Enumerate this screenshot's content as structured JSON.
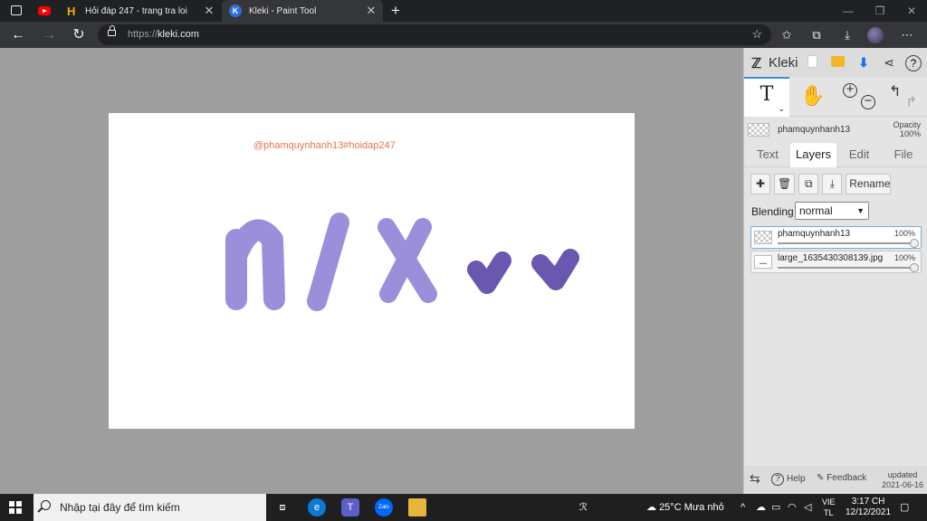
{
  "browser": {
    "tabs": [
      {
        "title": "",
        "icon": "youtube-icon"
      },
      {
        "title": "Hỏi đáp 247 - trang tra loi",
        "icon": "hoidap-icon"
      },
      {
        "title": "Kleki - Paint Tool",
        "icon": "kleki-icon"
      }
    ],
    "url_scheme": "https://",
    "url_host": "kleki.com"
  },
  "canvas": {
    "watermark": "@phamquynhanh13#hoidap247",
    "stroke_colors": {
      "light": "#9b8fdc",
      "dark": "#6a57b0"
    }
  },
  "panel": {
    "brand": "Kleki",
    "current_layer_name": "phamquynhanh13",
    "opacity_label": "Opacity",
    "opacity_value": "100%",
    "tabs": [
      "Text",
      "Layers",
      "Edit",
      "File"
    ],
    "active_tab": "Layers",
    "rename_label": "Rename",
    "blending_label": "Blending",
    "blending_value": "normal",
    "layers": [
      {
        "name": "phamquynhanh13",
        "opacity": "100%",
        "selected": true
      },
      {
        "name": "large_1635430308139.jpg",
        "opacity": "100%",
        "selected": false
      }
    ],
    "footer": {
      "help": "Help",
      "feedback": "Feedback",
      "updated_label": "updated",
      "updated_date": "2021-06-16"
    }
  },
  "taskbar": {
    "search_placeholder": "Nhập tại đây để tìm kiếm",
    "weather": "25°C  Mưa nhỏ",
    "lang_top": "VIE",
    "lang_bottom": "TL",
    "time": "3:17 CH",
    "date": "12/12/2021",
    "zalo_label": "Zalo"
  },
  "colors": {
    "accent_blue": "#3b8beb",
    "watermark": "#e8734e"
  }
}
